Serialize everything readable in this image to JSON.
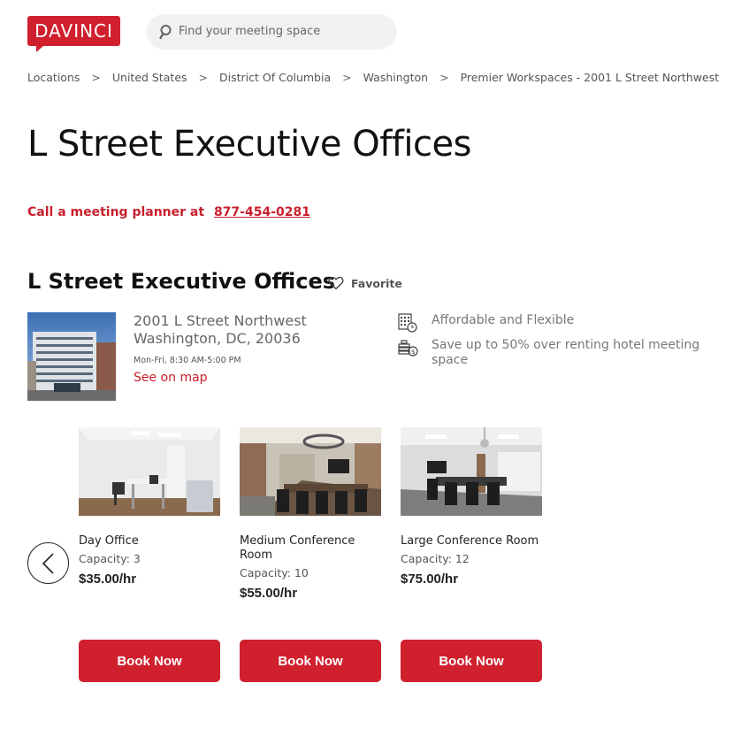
{
  "header": {
    "logo_text": "DAVINCI",
    "search_placeholder": "Find your meeting space"
  },
  "breadcrumb": [
    "Locations",
    "United States",
    "District Of Columbia",
    "Washington",
    "Premier Workspaces - 2001 L Street Northwest"
  ],
  "breadcrumb_separator": ">",
  "page_title": "L Street Executive Offices",
  "call": {
    "text": "Call a meeting planner at",
    "phone": "877-454-0281"
  },
  "venue": {
    "name": "L Street Executive Offices",
    "favorite_label": "Favorite",
    "address_line1": "2001 L Street Northwest",
    "address_line2": "Washington, DC, 20036",
    "hours": "Mon-Fri, 8:30 AM-5:00 PM",
    "map_link": "See on map",
    "features": [
      "Affordable and Flexible",
      "Save up to 50% over renting hotel meeting space"
    ]
  },
  "rooms": [
    {
      "name": "Day Office",
      "capacity": "Capacity: 3",
      "price": "$35.00/hr",
      "cta": "Book Now"
    },
    {
      "name": "Medium Conference Room",
      "capacity": "Capacity: 10",
      "price": "$55.00/hr",
      "cta": "Book Now"
    },
    {
      "name": "Large Conference Room",
      "capacity": "Capacity: 12",
      "price": "$75.00/hr",
      "cta": "Book Now"
    }
  ],
  "colors": {
    "brand": "#d0202e"
  }
}
